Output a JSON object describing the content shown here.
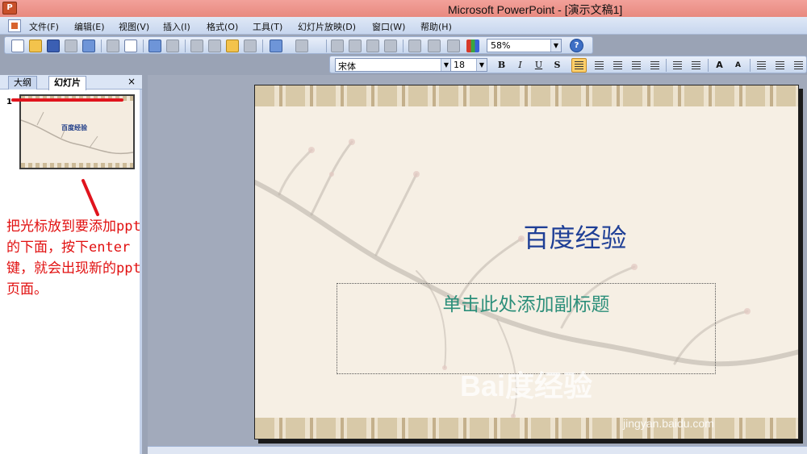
{
  "window": {
    "title": "Microsoft PowerPoint - [演示文稿1]"
  },
  "menu": {
    "items": [
      "文件(F)",
      "编辑(E)",
      "视图(V)",
      "插入(I)",
      "格式(O)",
      "工具(T)",
      "幻灯片放映(D)",
      "窗口(W)",
      "帮助(H)"
    ]
  },
  "toolbar": {
    "zoom": "58%",
    "font": "宋体",
    "font_size": "18",
    "bold": "B",
    "italic": "I",
    "underline": "U",
    "shadow": "S"
  },
  "left_panel": {
    "tabs": [
      "大纲",
      "幻灯片"
    ],
    "active_tab": "幻灯片",
    "close": "×",
    "slide_number": "1",
    "thumb_title": "百度经验"
  },
  "annotation": {
    "lines": [
      "把光标放到要添加ppt",
      "的下面，按下enter",
      "键，就会出现新的ppt",
      "页面。"
    ],
    "color": "#e11010"
  },
  "slide": {
    "title": "百度经验",
    "subtitle_placeholder": "单击此处添加副标题"
  },
  "watermark": {
    "text": "Bai度经验",
    "url": "jingyan.baidu.com"
  }
}
